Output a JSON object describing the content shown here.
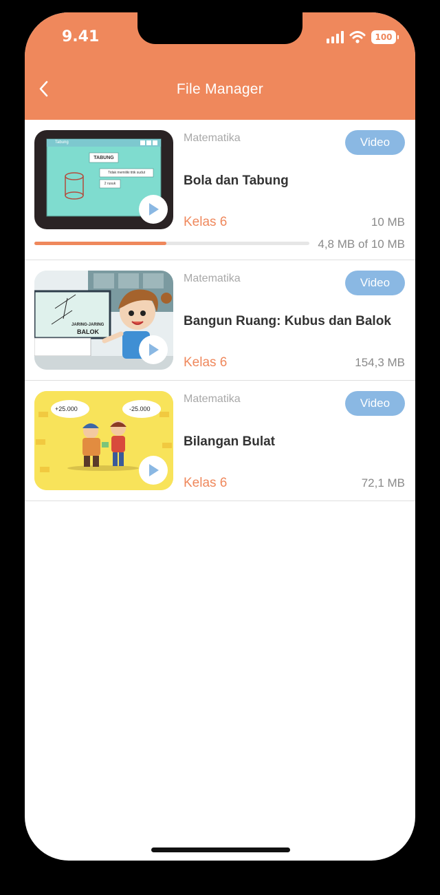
{
  "status_bar": {
    "time": "9.41",
    "battery": "100"
  },
  "header": {
    "title": "File Manager",
    "back_icon": "chevron-left-icon"
  },
  "colors": {
    "accent": "#ef885c",
    "badge": "#8ab8e3",
    "play": "#8ab8e3"
  },
  "files": [
    {
      "subject": "Matematika",
      "badge": "Video",
      "name": "Bola dan Tabung",
      "grade": "Kelas 6",
      "size": "10 MB",
      "download": {
        "text": "4,8 MB of 10 MB",
        "progress": 0.48
      },
      "thumb_texts": {
        "window_title": "Tabung",
        "label": "TABUNG",
        "note1": "Tidak memiliki titik sudut",
        "note2": "2 rusuk"
      }
    },
    {
      "subject": "Matematika",
      "badge": "Video",
      "name": "Bangun Ruang: Kubus dan Balok",
      "grade": "Kelas 6",
      "size": "154,3 MB",
      "thumb_texts": {
        "line1": "JARING-JARING",
        "line2": "BALOK"
      }
    },
    {
      "subject": "Matematika",
      "badge": "Video",
      "name": "Bilangan Bulat",
      "grade": "Kelas 6",
      "size": "72,1 MB",
      "thumb_texts": {
        "left": "+25.000",
        "right": "-25.000"
      }
    }
  ]
}
